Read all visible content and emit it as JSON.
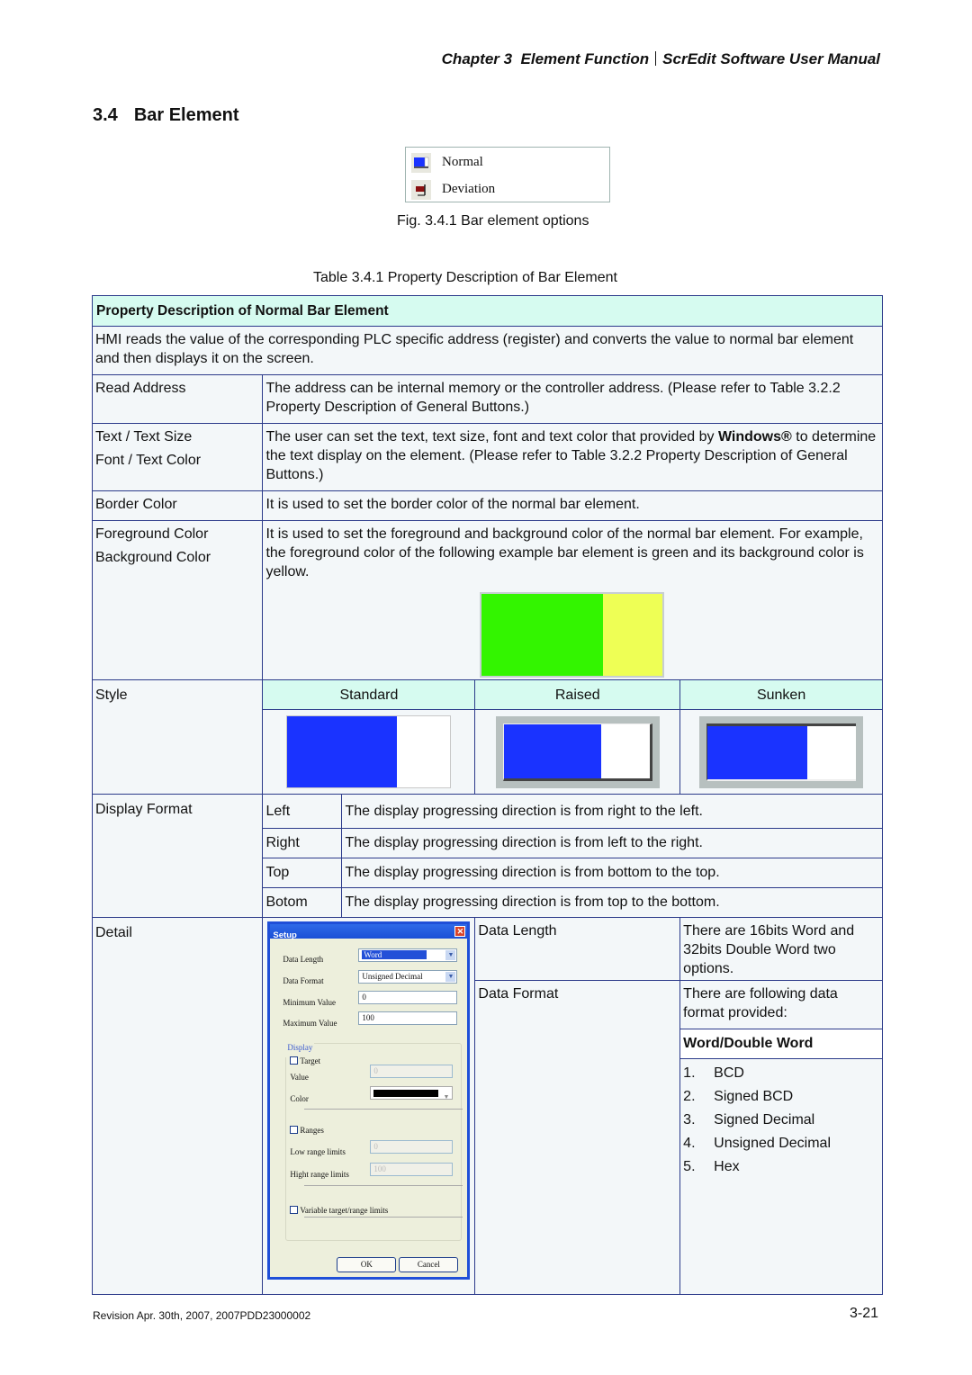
{
  "header": {
    "chapter": "Chapter 3",
    "section": "Element Function",
    "manual": "ScrEdit Software User Manual"
  },
  "section": {
    "number": "3.4",
    "title": "Bar Element"
  },
  "figure": {
    "options": [
      {
        "icon": "normal-bar-icon",
        "label": "Normal"
      },
      {
        "icon": "deviation-bar-icon",
        "label": "Deviation"
      }
    ],
    "caption": "Fig. 3.4.1 Bar element options"
  },
  "table": {
    "caption": "Table 3.4.1 Property Description of Bar Element",
    "heading": "Property Description of Normal Bar Element",
    "intro": "HMI reads the value of the corresponding PLC specific address  (register) and converts the value to normal bar element and then displays it on the screen.",
    "rows": {
      "read_address": {
        "label": "Read Address",
        "desc": "The address can be internal memory or the controller address. (Please refer to Table 3.2.2 Property Description of General Buttons.)"
      },
      "text": {
        "label1": "Text / Text Size",
        "label2": "Font / Text Color",
        "desc_pre": "The user can set the text, text size, font and text color that provided by ",
        "desc_bold": "Windows®",
        "desc_post": " to determine the text display on the element. (Please refer to Table 3.2.2 Property Description of General Buttons.)"
      },
      "border": {
        "label": "Border Color",
        "desc": "It is used to set the border color of the normal bar element."
      },
      "colors": {
        "label1": "Foreground Color",
        "label2": "Background Color",
        "desc": "It is used to set the foreground and background color of the normal bar element. For example, the foreground color of the following example bar element is green and its background color is yellow.",
        "example_fill": 0.67,
        "fg_color": "#33f500",
        "bg_color": "#eeff55"
      },
      "style": {
        "label": "Style",
        "options": [
          "Standard",
          "Raised",
          "Sunken"
        ],
        "fill": 0.67,
        "bar_color": "#1a33ff"
      },
      "display_format": {
        "label": "Display Format",
        "items": [
          {
            "dir": "Left",
            "desc": "The display progressing direction is from right to the left."
          },
          {
            "dir": "Right",
            "desc": "The display progressing direction is from left to the right."
          },
          {
            "dir": "Top",
            "desc": "The display progressing direction is from bottom to the top."
          },
          {
            "dir": "Botom",
            "desc": "The display progressing direction is from top to the bottom."
          }
        ]
      },
      "detail": {
        "label": "Detail",
        "data_length": {
          "label": "Data Length",
          "desc": "There are 16bits Word and 32bits Double Word two options."
        },
        "data_format": {
          "label": "Data Format",
          "desc": "There are following data format provided:",
          "subheading": "Word/Double Word",
          "formats": [
            "BCD",
            "Signed BCD",
            "Signed Decimal",
            "Unsigned Decimal",
            "Hex"
          ]
        }
      }
    }
  },
  "dialog": {
    "title": "Setup",
    "data_length_label": "Data Length",
    "data_length_value": "Word",
    "data_format_label": "Data Format",
    "data_format_value": "Unsigned Decimal",
    "min_label": "Minimum Value",
    "min_value": "0",
    "max_label": "Maximum Value",
    "max_value": "100",
    "display_group": "Display",
    "target_label": "Target",
    "value_label": "Value",
    "value_value": "0",
    "color_label": "Color",
    "ranges_label": "Ranges",
    "low_label": "Low range limits",
    "low_value": "0",
    "high_label": "Hight range limits",
    "high_value": "100",
    "variable_label": "Variable target/range limits",
    "ok": "OK",
    "cancel": "Cancel"
  },
  "footer": {
    "revision": "Revision Apr. 30th, 2007, 2007PDD23000002",
    "page": "3-21"
  }
}
